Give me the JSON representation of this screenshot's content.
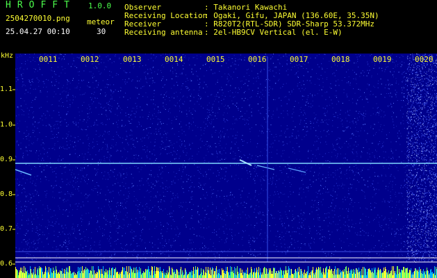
{
  "header": {
    "app_title": "HROFFT",
    "version": "1.0.0",
    "file_name": "2504270010.png",
    "meteor_label": "meteor",
    "date_time": "25.04.27 00:10",
    "meteor_count": "30"
  },
  "info": {
    "observer_key": "Observer",
    "observer_val": ": Takanori Kawachi",
    "location_key": "Receiving Location",
    "location_val": ": Ogaki, Gifu, JAPAN (136.60E, 35.35N)",
    "receiver_key": "Receiver",
    "receiver_val": ": R820T2(RTL-SDR) SDR-Sharp 53.372MHz",
    "antenna_key": "Receiving antenna",
    "antenna_val": ": 2el-HB9CV Vertical (el. E-W)"
  },
  "axis": {
    "y_unit": "kHz",
    "y_ticks": [
      "1.1",
      "1.0",
      "0.9",
      "0.8",
      "0.7",
      "0.6"
    ],
    "x_ticks": [
      "0011",
      "0012",
      "0013",
      "0014",
      "0015",
      "0016",
      "0017",
      "0018",
      "0019",
      "0020"
    ]
  },
  "colors": {
    "background": "#00008c",
    "signal": "#7fd7ff",
    "label": "#ffff33",
    "title": "#4cff4c"
  }
}
